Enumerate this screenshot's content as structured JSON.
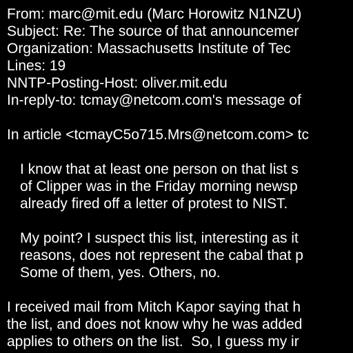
{
  "colors": {
    "background": "#000000",
    "text": "#ffffff"
  },
  "header": {
    "from": "From: marc@mit.edu (Marc Horowitz N1NZU)",
    "subject": "Subject: Re: The source of that announcemer",
    "organization": "Organization: Massachusetts Institute of Tec",
    "lines": "Lines: 19",
    "nntp_host": "NNTP-Posting-Host: oliver.mit.edu",
    "in_reply_to": "In-reply-to: tcmay@netcom.com's message of"
  },
  "body": {
    "attribution": "In article <tcmayC5o715.Mrs@netcom.com> tc",
    "quote1": [
      "I know that at least one person on that list s",
      "of Clipper was in the Friday morning newsp",
      "already fired off a letter of protest to NIST."
    ],
    "quote2": [
      "My point? I suspect this list, interesting as it",
      "reasons, does not represent the cabal that p",
      "Some of them, yes. Others, no."
    ],
    "reply": [
      "I received mail from Mitch Kapor saying that h",
      "the list, and does not know why he was added",
      "applies to others on the list.  So, I guess my ir"
    ]
  }
}
